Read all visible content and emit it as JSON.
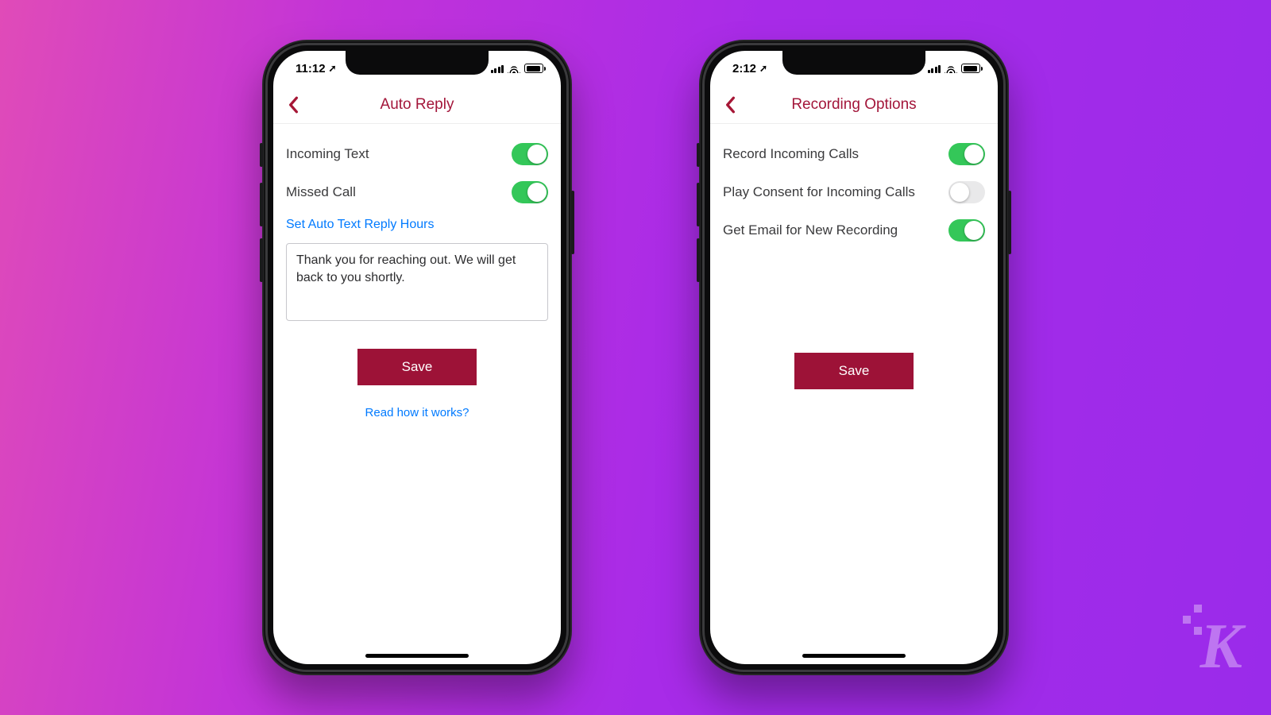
{
  "watermark": "K",
  "phones": {
    "left": {
      "status": {
        "time": "11:12",
        "location_arrow": "➚"
      },
      "nav": {
        "title": "Auto Reply"
      },
      "rows": [
        {
          "label": "Incoming Text",
          "on": true
        },
        {
          "label": "Missed Call",
          "on": true
        }
      ],
      "link_hours": "Set Auto Text Reply Hours",
      "message": "Thank you for reaching out. We will get back to you shortly.",
      "save_label": "Save",
      "help_link": "Read how it works?"
    },
    "right": {
      "status": {
        "time": "2:12",
        "location_arrow": "➚"
      },
      "nav": {
        "title": "Recording Options"
      },
      "rows": [
        {
          "label": "Record Incoming Calls",
          "on": true
        },
        {
          "label": "Play Consent for Incoming Calls",
          "on": false
        },
        {
          "label": "Get Email for New Recording",
          "on": true
        }
      ],
      "save_label": "Save"
    }
  }
}
